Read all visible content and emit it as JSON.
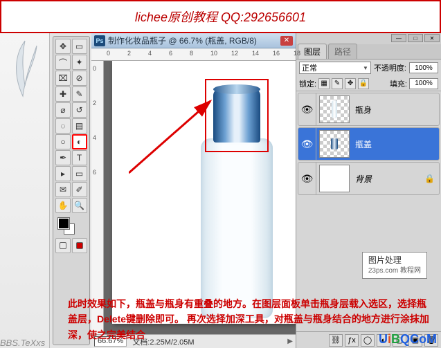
{
  "banner": {
    "text": "lichee原创教程 QQ:292656601"
  },
  "doc": {
    "title": "制作化妆品瓶子 @ 66.7% (瓶盖, RGB/8)",
    "zoom": "66.67%",
    "docsize_label": "文档:2.25M/2.05M"
  },
  "ruler": {
    "h": [
      "0",
      "2",
      "4",
      "6",
      "8",
      "10",
      "12",
      "14",
      "16",
      "18"
    ],
    "v": [
      "0",
      "2",
      "4",
      "6"
    ]
  },
  "tools": [
    {
      "name": "move",
      "glyph": "✥"
    },
    {
      "name": "marquee",
      "glyph": "▭"
    },
    {
      "name": "lasso",
      "glyph": "⌒"
    },
    {
      "name": "wand",
      "glyph": "✦"
    },
    {
      "name": "crop",
      "glyph": "✂"
    },
    {
      "name": "slice",
      "glyph": "⊘"
    },
    {
      "name": "healing",
      "glyph": "✚"
    },
    {
      "name": "brush",
      "glyph": "✎"
    },
    {
      "name": "stamp",
      "glyph": "⌀"
    },
    {
      "name": "history-brush",
      "glyph": "↺"
    },
    {
      "name": "eraser",
      "glyph": "◌"
    },
    {
      "name": "gradient",
      "glyph": "▤"
    },
    {
      "name": "blur",
      "glyph": "○"
    },
    {
      "name": "burn",
      "glyph": "◐",
      "selected": true
    },
    {
      "name": "pen",
      "glyph": "✒"
    },
    {
      "name": "type",
      "glyph": "T"
    },
    {
      "name": "path-select",
      "glyph": "▸"
    },
    {
      "name": "shape",
      "glyph": "▭"
    },
    {
      "name": "notes",
      "glyph": "✉"
    },
    {
      "name": "eyedropper",
      "glyph": "✐"
    },
    {
      "name": "hand",
      "glyph": "✋"
    },
    {
      "name": "zoom",
      "glyph": "🔍"
    }
  ],
  "layers_panel": {
    "tab_layers": "图层",
    "tab_paths": "路径",
    "blend_mode": "正常",
    "opacity_label": "不透明度:",
    "opacity_value": "100%",
    "lock_label": "锁定:",
    "fill_label": "填充:",
    "fill_value": "100%",
    "layers": [
      {
        "name": "瓶身",
        "selected": false,
        "thumb": "body"
      },
      {
        "name": "瓶盖",
        "selected": true,
        "thumb": "cap"
      },
      {
        "name": "背景",
        "selected": false,
        "thumb": "bg",
        "locked": true
      }
    ]
  },
  "watermark": {
    "line1": "图片处理",
    "line2": "23ps.com",
    "line3": "教程网"
  },
  "instruction": {
    "text": "此时效果如下，瓶盖与瓶身有重叠的地方。在图层面板单击瓶身层载入选区，选择瓶盖层，Delete键删除即可。 再次选择加深工具，对瓶盖与瓶身结合的地方进行涂抹加深，使之完美结合"
  },
  "site": {
    "brand_u": "U",
    "brand_i": "i",
    "brand_b": "B",
    "brand_q": "Q",
    ".": ".",
    "com": "CoM"
  },
  "bbs": "BBS.TeXxs"
}
